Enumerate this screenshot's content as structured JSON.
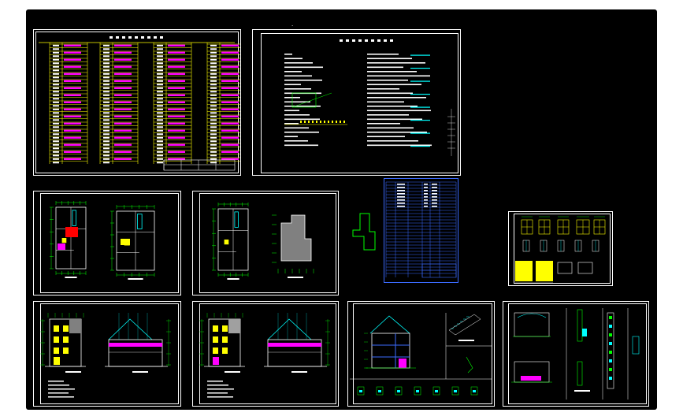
{
  "drawing": {
    "title": "",
    "background_color": "#000000",
    "line_color": "#ffffff",
    "accent_colors": {
      "yellow": "#ffff00",
      "magenta": "#ff00ff",
      "green": "#00ff00",
      "cyan": "#00ffff",
      "red": "#ff0000",
      "blue": "#3b6bff",
      "gray": "#808080"
    },
    "sheets": [
      {
        "id": "drawing-index",
        "kind": "table",
        "label": ""
      },
      {
        "id": "design-notes",
        "kind": "notes",
        "label": ""
      },
      {
        "id": "floor-plans-1-2",
        "kind": "plans",
        "label": ""
      },
      {
        "id": "floor-plans-3-roof",
        "kind": "plans",
        "label": ""
      },
      {
        "id": "door-window-schedule",
        "kind": "table",
        "label": ""
      },
      {
        "id": "door-window-details",
        "kind": "details",
        "label": ""
      },
      {
        "id": "elevations-1",
        "kind": "elevations",
        "label": ""
      },
      {
        "id": "elevations-2",
        "kind": "elevations",
        "label": ""
      },
      {
        "id": "section-stair",
        "kind": "section",
        "label": ""
      },
      {
        "id": "wall-details",
        "kind": "details",
        "label": ""
      }
    ],
    "site_outline": {
      "label": ""
    }
  }
}
